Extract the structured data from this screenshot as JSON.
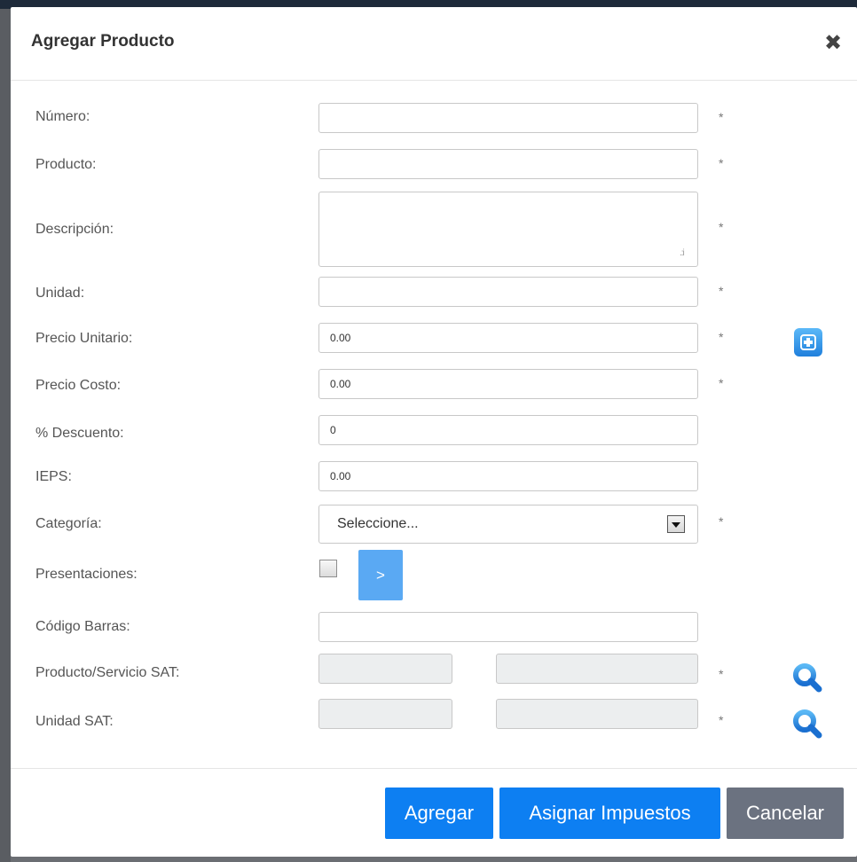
{
  "modal": {
    "title": "Agregar Producto",
    "close_glyph": "✖"
  },
  "form": {
    "numero": {
      "label": "Número:",
      "value": "",
      "required_mark": "*"
    },
    "producto": {
      "label": "Producto:",
      "value": "",
      "required_mark": "*"
    },
    "descripcion": {
      "label": "Descripción:",
      "value": "",
      "required_mark": "*"
    },
    "unidad": {
      "label": "Unidad:",
      "value": "",
      "required_mark": "*"
    },
    "precio_unitario": {
      "label": "Precio Unitario:",
      "value": "0.00",
      "required_mark": "*",
      "action_icon": "add-square-icon"
    },
    "precio_costo": {
      "label": "Precio Costo:",
      "value": "0.00",
      "required_mark": "*"
    },
    "descuento": {
      "label": "% Descuento:",
      "value": "0"
    },
    "ieps": {
      "label": "IEPS:",
      "value": "0.00"
    },
    "categoria": {
      "label": "Categoría:",
      "selected": "Seleccione...",
      "required_mark": "*"
    },
    "presentaciones": {
      "label": "Presentaciones:",
      "checked": false,
      "button_label": ">"
    },
    "codigo_barras": {
      "label": "Código Barras:",
      "value": ""
    },
    "producto_servicio_sat": {
      "label": "Producto/Servicio SAT:",
      "code": "",
      "description": "",
      "required_mark": "*",
      "action_icon": "search-icon"
    },
    "unidad_sat": {
      "label": "Unidad SAT:",
      "code": "",
      "description": "",
      "required_mark": "*",
      "action_icon": "search-icon"
    }
  },
  "footer": {
    "add_label": "Agregar",
    "taxes_label": "Asignar Impuestos",
    "cancel_label": "Cancelar"
  },
  "colors": {
    "primary": "#0d7ff2",
    "secondary": "#6b7280",
    "light_button": "#5aa9f3",
    "readonly_bg": "#eceeef"
  }
}
